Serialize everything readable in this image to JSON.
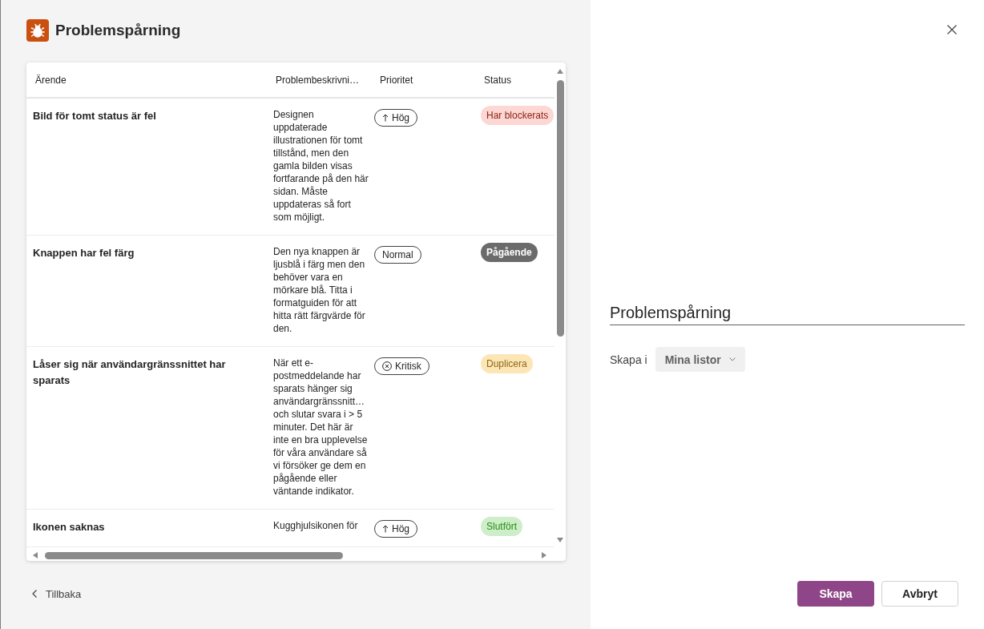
{
  "app": {
    "title": "Problemspårning"
  },
  "table": {
    "columns": [
      "Ärende",
      "Problembeskrivni…",
      "Prioritet",
      "Status"
    ],
    "rows": [
      {
        "issue": "Bild för tomt status är fel",
        "description": "Designen uppdaterade illustrationen för tomt tillstånd, men den gamla bilden visas fortfarande på den här sidan. Måste uppdateras så fort som möjligt.",
        "priority": {
          "label": "Hög",
          "kind": "high"
        },
        "status": {
          "label": "Har blockerats",
          "color": "#fcd7d3"
        }
      },
      {
        "issue": "Knappen har fel färg",
        "description": "Den nya knappen är ljusblå i färg men den behöver vara en mörkare blå. Titta i formatguiden för att hitta rätt färgvärde för den.",
        "priority": {
          "label": "Normal",
          "kind": "normal"
        },
        "status": {
          "label": "Pågående",
          "color": "#6b6b6b"
        }
      },
      {
        "issue": "Låser sig när användargränssnittet har sparats",
        "description": "När ett e-postmeddelande har sparats hänger sig användargränssnitt… och slutar svara i > 5 minuter. Det här är inte en bra upplevelse för våra användare så vi försöker ge dem en pågående eller väntande indikator.",
        "priority": {
          "label": "Kritisk",
          "kind": "critical"
        },
        "status": {
          "label": "Duplicera",
          "color": "#fde6b5"
        }
      },
      {
        "issue": "Ikonen saknas",
        "description": "Kugghjulsikonen för",
        "priority": {
          "label": "Hög",
          "kind": "high"
        },
        "status": {
          "label": "Slutfört",
          "color": "#cdeec8"
        }
      }
    ]
  },
  "back_link": {
    "label": "Tillbaka"
  },
  "panel": {
    "name_field": {
      "value": "Problemspårning"
    },
    "location": {
      "label": "Skapa i",
      "value": "Mina listor"
    }
  },
  "buttons": [
    {
      "label": "Skapa",
      "kind": "primary"
    },
    {
      "label": "Avbryt",
      "kind": "secondary"
    }
  ]
}
